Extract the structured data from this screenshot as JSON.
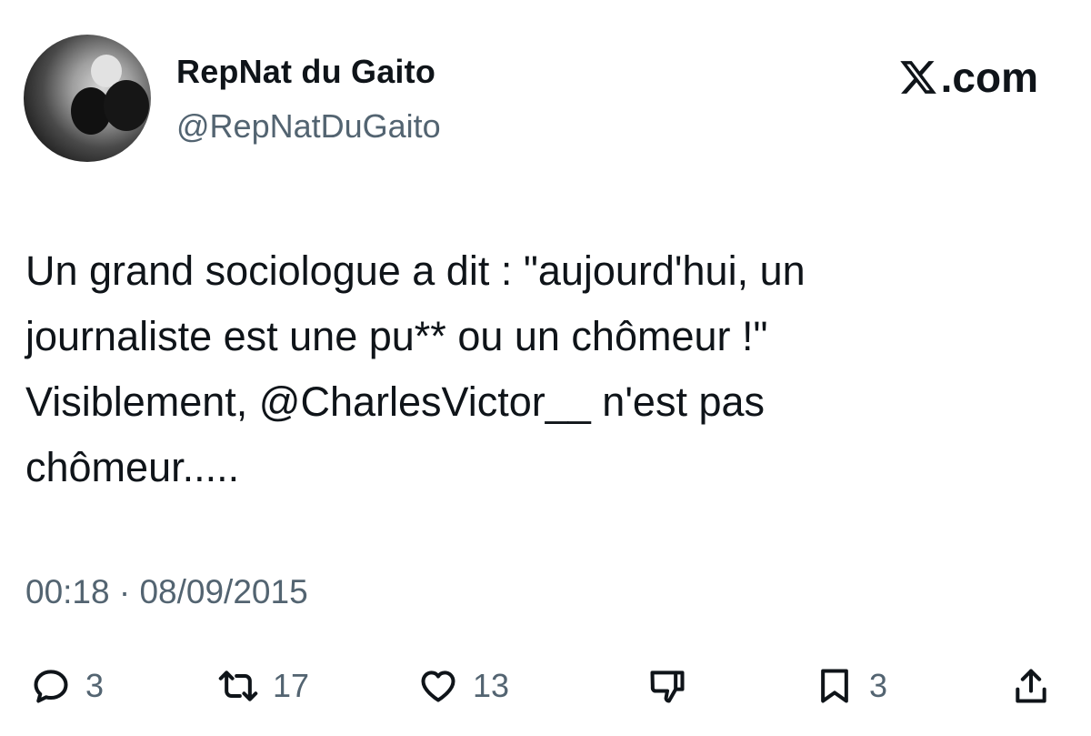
{
  "author": {
    "name": "RepNat du Gaito",
    "handle": "@RepNatDuGaito"
  },
  "brand": {
    "label": ".com",
    "icon": "x-logo-icon"
  },
  "tweet": {
    "text": "Un grand sociologue a dit : \"aujourd'hui, un\njournaliste est une pu** ou un chômeur !\"\nVisiblement, @CharlesVictor__ n'est pas\nchômeur.....",
    "timestamp": "00:18 · 08/09/2015"
  },
  "actions": {
    "reply": {
      "icon": "reply-bubble-icon",
      "count": "3"
    },
    "retweet": {
      "icon": "retweet-icon",
      "count": "17"
    },
    "like": {
      "icon": "heart-icon",
      "count": "13"
    },
    "dislike": {
      "icon": "thumbs-down-icon"
    },
    "bookmark": {
      "icon": "bookmark-icon",
      "count": "3"
    },
    "share": {
      "icon": "share-icon"
    }
  },
  "colors": {
    "text": "#0f1419",
    "muted": "#536471",
    "background": "#ffffff"
  }
}
